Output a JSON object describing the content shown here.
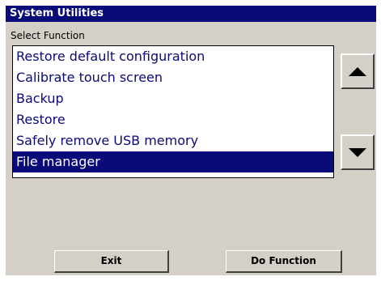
{
  "window": {
    "title": "System Utilities"
  },
  "main": {
    "section_label": "Select Function",
    "items": [
      {
        "label": "Restore default configuration",
        "selected": false
      },
      {
        "label": "Calibrate touch screen",
        "selected": false
      },
      {
        "label": "Backup",
        "selected": false
      },
      {
        "label": "Restore",
        "selected": false
      },
      {
        "label": "Safely remove USB memory",
        "selected": false
      },
      {
        "label": "File manager",
        "selected": true
      }
    ],
    "scroll_up_icon": "triangle-up",
    "scroll_down_icon": "triangle-down"
  },
  "footer": {
    "exit_label": "Exit",
    "do_function_label": "Do Function"
  },
  "colors": {
    "titlebar": "#0a0a78",
    "panel": "#d4d0c8",
    "list_text": "#0a0a78",
    "selection": "#0a0a78"
  }
}
